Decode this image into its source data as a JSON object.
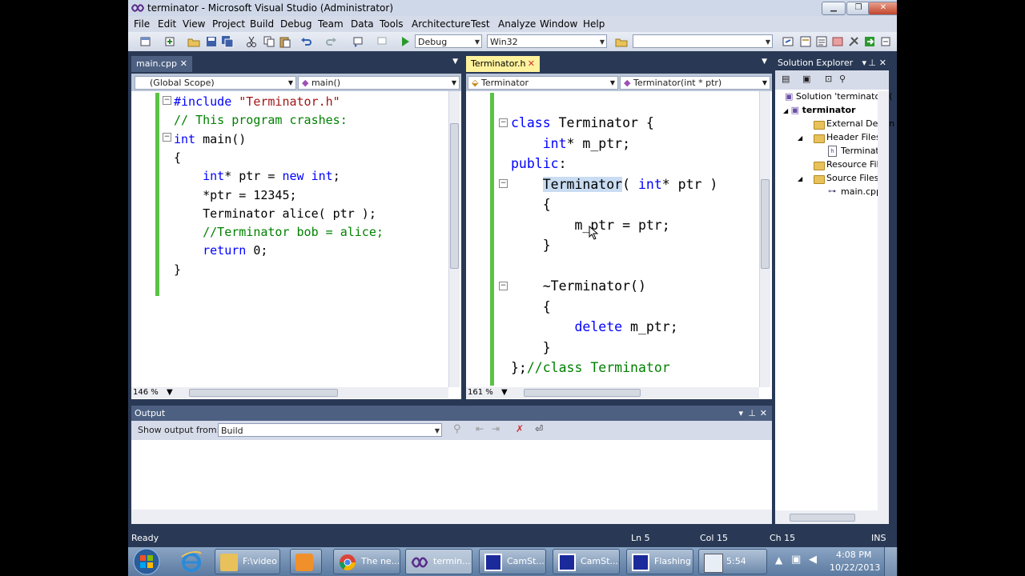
{
  "window": {
    "title": "terminator - Microsoft Visual Studio (Administrator)"
  },
  "menu": [
    "File",
    "Edit",
    "View",
    "Project",
    "Build",
    "Debug",
    "Team",
    "Data",
    "Tools",
    "Architecture",
    "Test",
    "Analyze",
    "Window",
    "Help"
  ],
  "toolbar": {
    "config": "Debug",
    "platform": "Win32",
    "find": ""
  },
  "left_editor": {
    "tab": "main.cpp",
    "scope": "(Global Scope)",
    "member": "main()",
    "zoom": "146 %"
  },
  "right_editor": {
    "tab": "Terminator.h",
    "scope": "Terminator",
    "member": "Terminator(int * ptr)",
    "zoom": "161 %"
  },
  "solution_explorer": {
    "title": "Solution Explorer",
    "items": [
      "Solution 'terminator' (",
      "terminator",
      "External Depen",
      "Header Files",
      "Terminator",
      "Resource Files",
      "Source Files",
      "main.cpp"
    ]
  },
  "output": {
    "title": "Output",
    "show_from_label": "Show output from:",
    "source": "Build"
  },
  "status": {
    "ready": "Ready",
    "line": "Ln 5",
    "col": "Col 15",
    "ch": "Ch 15",
    "mode": "INS"
  },
  "taskbar": {
    "items": [
      "F:\\video",
      "The ne...",
      "termin...",
      "CamSt...",
      "CamSt...",
      "Flashing",
      "5:54"
    ],
    "time": "4:08 PM",
    "date": "10/22/2013"
  },
  "colors": {
    "frame": "#293955",
    "keyword": "#0000ff",
    "comment": "#008000",
    "string": "#a31515",
    "active_tab": "#fff1c7"
  }
}
